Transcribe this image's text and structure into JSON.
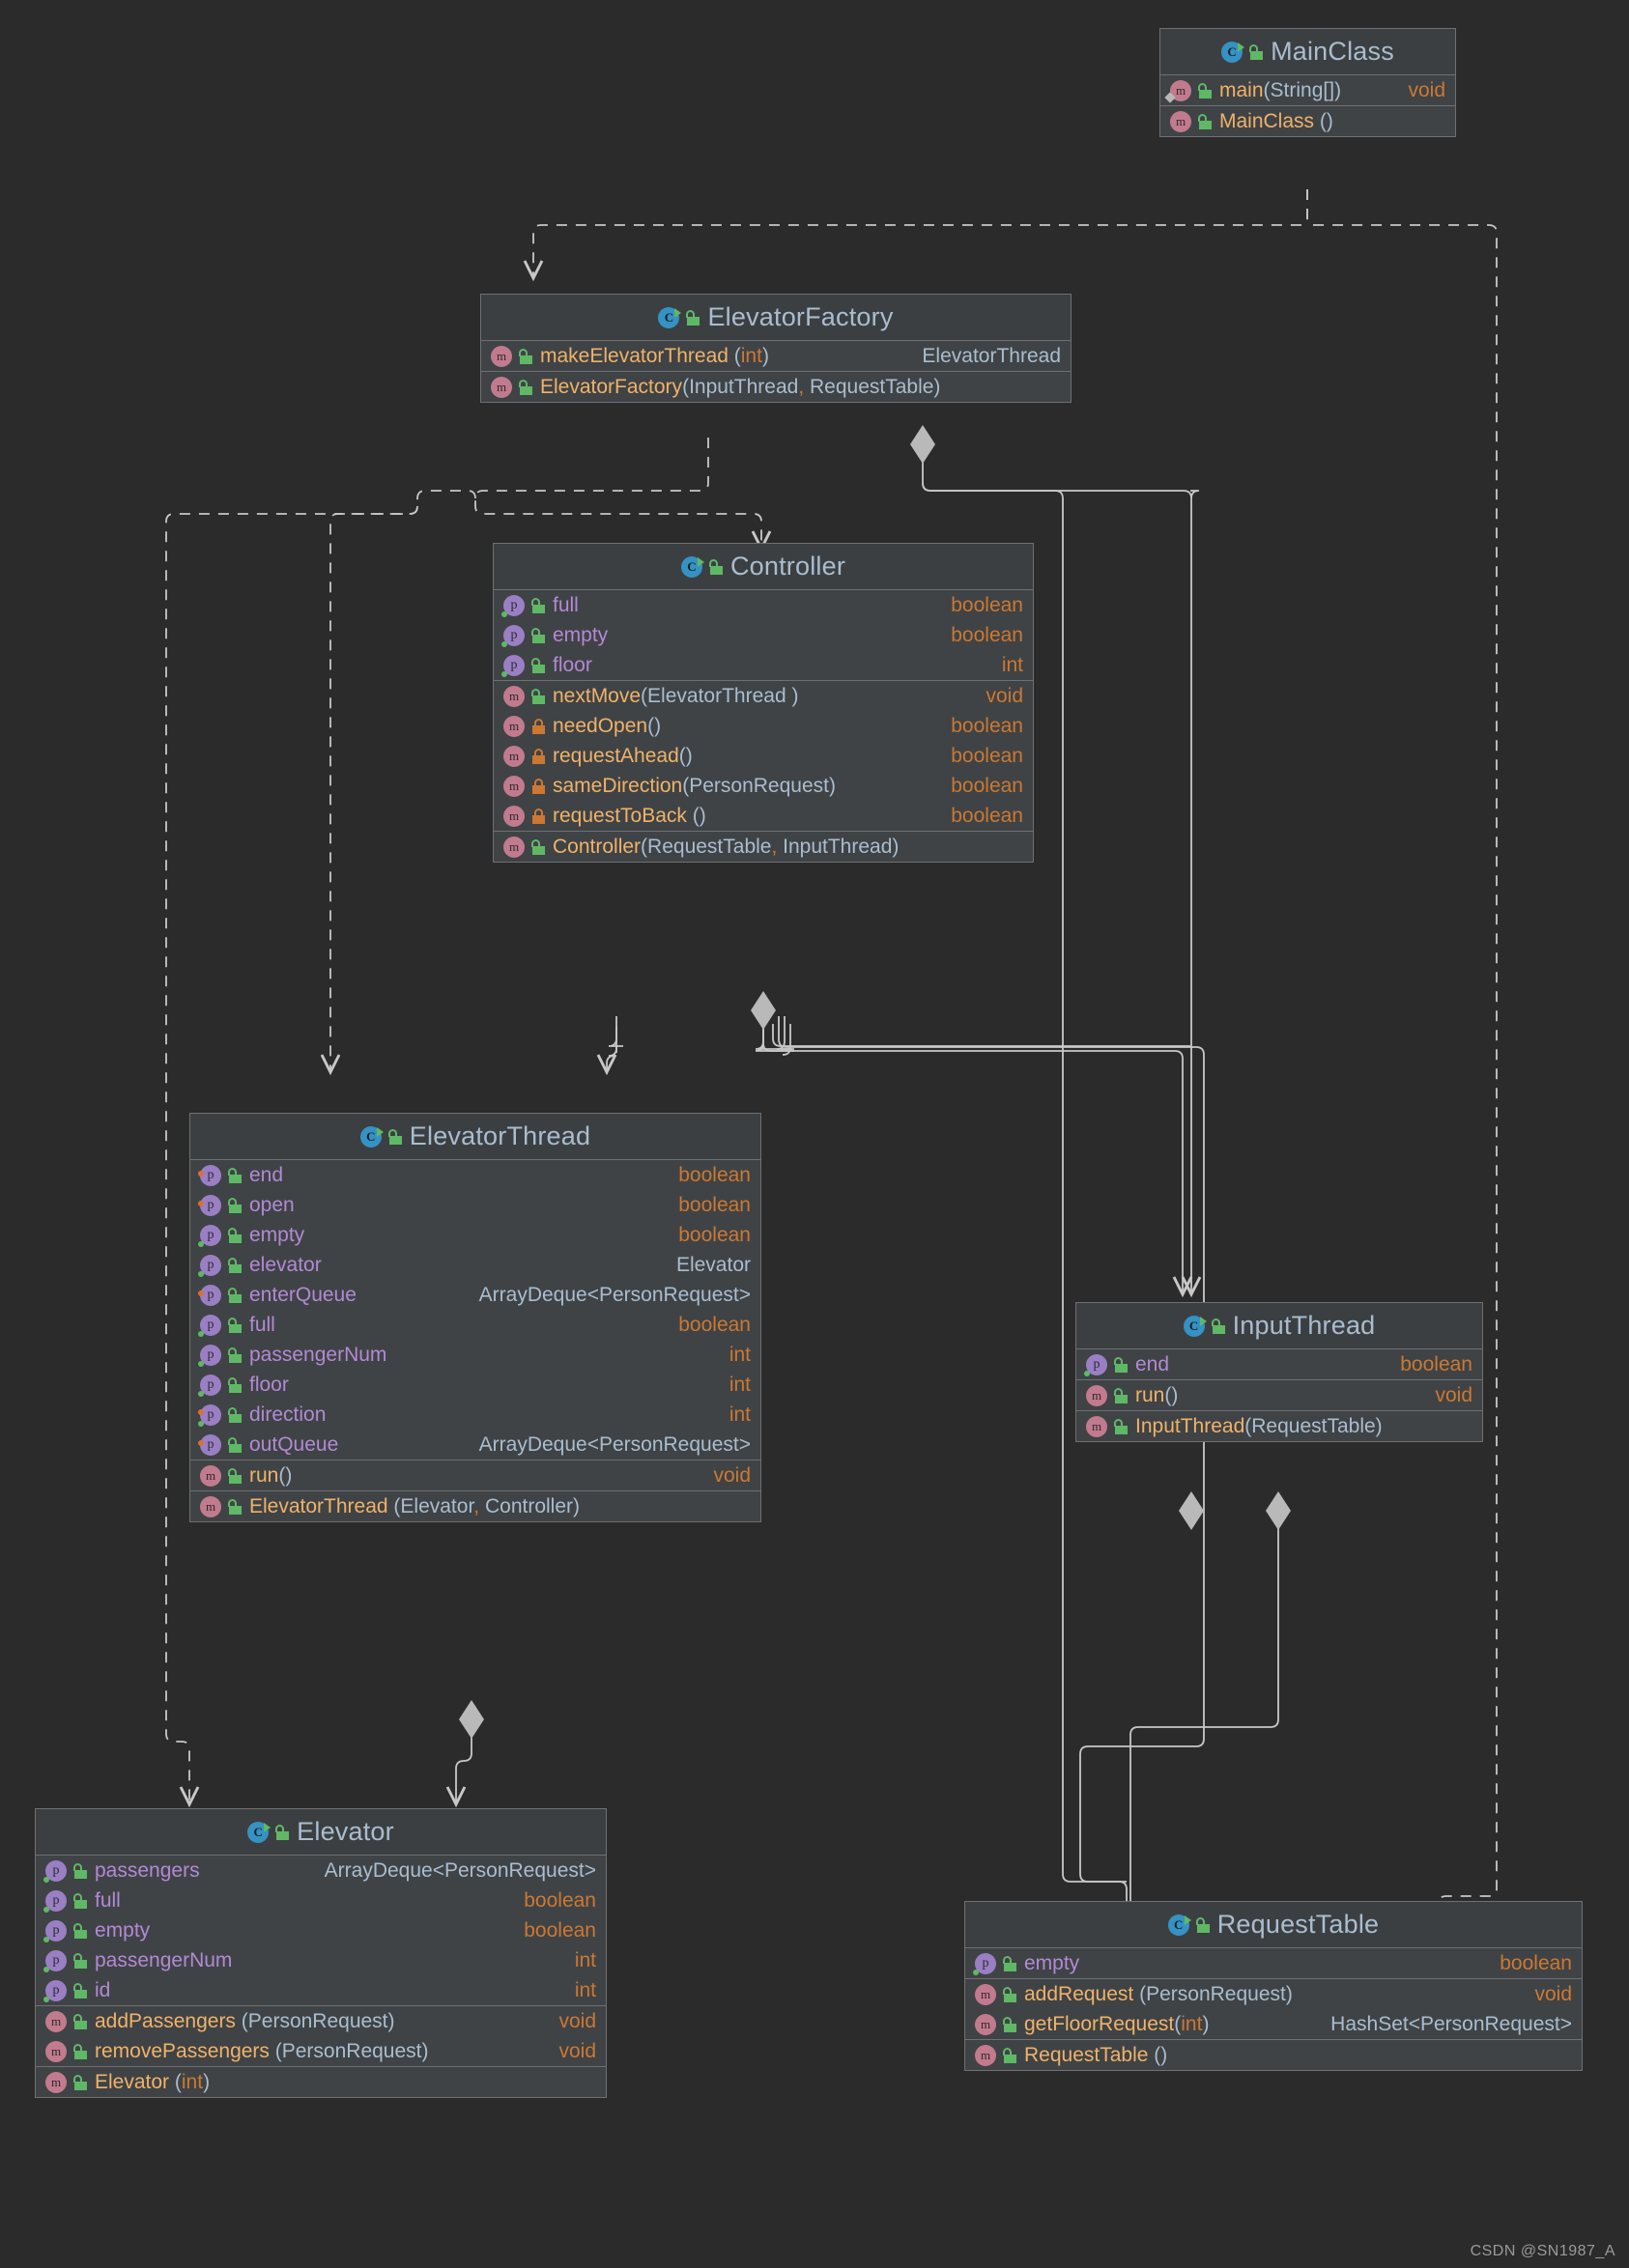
{
  "diagram": {
    "kind": "uml-class-diagram",
    "background_color": "#2b2b2b",
    "box_header_color": "#3c3f41",
    "box_body_color": "#3f4345",
    "border_color": "#6e7072",
    "edge_color": "#c8c8c8",
    "watermark": "CSDN @SN1987_A"
  },
  "icon_legend": {
    "class": "class-icon",
    "property": "property-icon",
    "method": "method-icon",
    "public": "open-padlock-icon",
    "private": "closed-padlock-icon"
  },
  "classes": [
    {
      "id": "MainClass",
      "name": "MainClass",
      "visibility": "public",
      "sections": [
        {
          "members": [
            {
              "kind": "method",
              "visibility": "public",
              "name": "main",
              "params": "String[]",
              "return": "void",
              "marker": "diamond"
            }
          ]
        },
        {
          "members": [
            {
              "kind": "method",
              "visibility": "public",
              "name": "MainClass",
              "params": "",
              "return": ""
            }
          ]
        }
      ]
    },
    {
      "id": "ElevatorFactory",
      "name": "ElevatorFactory",
      "visibility": "public",
      "sections": [
        {
          "members": [
            {
              "kind": "method",
              "visibility": "public",
              "name": "makeElevatorThread",
              "params": "int",
              "param_prim": true,
              "return": "ElevatorThread"
            }
          ]
        },
        {
          "members": [
            {
              "kind": "method",
              "visibility": "public",
              "name": "ElevatorFactory",
              "params": "InputThread, RequestTable",
              "return": ""
            }
          ]
        }
      ]
    },
    {
      "id": "Controller",
      "name": "Controller",
      "visibility": "public",
      "sections": [
        {
          "members": [
            {
              "kind": "property",
              "visibility": "public",
              "name": "full",
              "return": "boolean",
              "marker": "green"
            },
            {
              "kind": "property",
              "visibility": "public",
              "name": "empty",
              "return": "boolean",
              "marker": "green"
            },
            {
              "kind": "property",
              "visibility": "public",
              "name": "floor",
              "return": "int",
              "marker": "green"
            }
          ]
        },
        {
          "members": [
            {
              "kind": "method",
              "visibility": "public",
              "name": "nextMove",
              "params": "ElevatorThread",
              "return": "void"
            },
            {
              "kind": "method",
              "visibility": "private",
              "name": "needOpen",
              "params": "",
              "return": "boolean"
            },
            {
              "kind": "method",
              "visibility": "private",
              "name": "requestAhead",
              "params": "",
              "return": "boolean"
            },
            {
              "kind": "method",
              "visibility": "private",
              "name": "sameDirection",
              "params": "PersonRequest",
              "return": "boolean"
            },
            {
              "kind": "method",
              "visibility": "private",
              "name": "requestToBack",
              "params": "",
              "return": "boolean"
            }
          ]
        },
        {
          "members": [
            {
              "kind": "method",
              "visibility": "public",
              "name": "Controller",
              "params": "RequestTable, InputThread",
              "return": ""
            }
          ]
        }
      ]
    },
    {
      "id": "ElevatorThread",
      "name": "ElevatorThread",
      "visibility": "public",
      "sections": [
        {
          "members": [
            {
              "kind": "property",
              "visibility": "public",
              "name": "end",
              "return": "boolean",
              "marker": "orange"
            },
            {
              "kind": "property",
              "visibility": "public",
              "name": "open",
              "return": "boolean",
              "marker": "orange"
            },
            {
              "kind": "property",
              "visibility": "public",
              "name": "empty",
              "return": "boolean",
              "marker": "green"
            },
            {
              "kind": "property",
              "visibility": "public",
              "name": "elevator",
              "return": "Elevator",
              "marker": "green"
            },
            {
              "kind": "property",
              "visibility": "public",
              "name": "enterQueue",
              "return": "ArrayDeque<PersonRequest>",
              "marker": "orange"
            },
            {
              "kind": "property",
              "visibility": "public",
              "name": "full",
              "return": "boolean",
              "marker": "green"
            },
            {
              "kind": "property",
              "visibility": "public",
              "name": "passengerNum",
              "return": "int",
              "marker": "green"
            },
            {
              "kind": "property",
              "visibility": "public",
              "name": "floor",
              "return": "int",
              "marker": "green"
            },
            {
              "kind": "property",
              "visibility": "public",
              "name": "direction",
              "return": "int",
              "marker": "both"
            },
            {
              "kind": "property",
              "visibility": "public",
              "name": "outQueue",
              "return": "ArrayDeque<PersonRequest>",
              "marker": "orange"
            }
          ]
        },
        {
          "members": [
            {
              "kind": "method",
              "visibility": "public",
              "name": "run",
              "params": "",
              "return": "void"
            }
          ]
        },
        {
          "members": [
            {
              "kind": "method",
              "visibility": "public",
              "name": "ElevatorThread",
              "params": "Elevator, Controller",
              "return": ""
            }
          ]
        }
      ]
    },
    {
      "id": "InputThread",
      "name": "InputThread",
      "visibility": "public",
      "sections": [
        {
          "members": [
            {
              "kind": "property",
              "visibility": "public",
              "name": "end",
              "return": "boolean",
              "marker": "green"
            }
          ]
        },
        {
          "members": [
            {
              "kind": "method",
              "visibility": "public",
              "name": "run",
              "params": "",
              "return": "void"
            }
          ]
        },
        {
          "members": [
            {
              "kind": "method",
              "visibility": "public",
              "name": "InputThread",
              "params": "RequestTable",
              "return": ""
            }
          ]
        }
      ]
    },
    {
      "id": "Elevator",
      "name": "Elevator",
      "visibility": "public",
      "sections": [
        {
          "members": [
            {
              "kind": "property",
              "visibility": "public",
              "name": "passengers",
              "return": "ArrayDeque<PersonRequest>",
              "marker": "green"
            },
            {
              "kind": "property",
              "visibility": "public",
              "name": "full",
              "return": "boolean",
              "marker": "green"
            },
            {
              "kind": "property",
              "visibility": "public",
              "name": "empty",
              "return": "boolean",
              "marker": "green"
            },
            {
              "kind": "property",
              "visibility": "public",
              "name": "passengerNum",
              "return": "int",
              "marker": "green"
            },
            {
              "kind": "property",
              "visibility": "public",
              "name": "id",
              "return": "int",
              "marker": "green"
            }
          ]
        },
        {
          "members": [
            {
              "kind": "method",
              "visibility": "public",
              "name": "addPassengers",
              "params": "PersonRequest",
              "return": "void"
            },
            {
              "kind": "method",
              "visibility": "public",
              "name": "removePassengers",
              "params": "PersonRequest",
              "return": "void"
            }
          ]
        },
        {
          "members": [
            {
              "kind": "method",
              "visibility": "public",
              "name": "Elevator",
              "params": "int",
              "param_prim": true,
              "return": ""
            }
          ]
        }
      ]
    },
    {
      "id": "RequestTable",
      "name": "RequestTable",
      "visibility": "public",
      "sections": [
        {
          "members": [
            {
              "kind": "property",
              "visibility": "public",
              "name": "empty",
              "return": "boolean",
              "marker": "green"
            }
          ]
        },
        {
          "members": [
            {
              "kind": "method",
              "visibility": "public",
              "name": "addRequest",
              "params": "PersonRequest",
              "return": "void"
            },
            {
              "kind": "method",
              "visibility": "public",
              "name": "getFloorRequest",
              "params": "int",
              "param_prim": true,
              "return": "HashSet<PersonRequest>"
            }
          ]
        },
        {
          "members": [
            {
              "kind": "method",
              "visibility": "public",
              "name": "RequestTable",
              "params": "",
              "return": ""
            }
          ]
        }
      ]
    }
  ],
  "relations": [
    {
      "from": "MainClass",
      "to": "ElevatorFactory",
      "type": "dependency"
    },
    {
      "from": "MainClass",
      "to": "RequestTable",
      "type": "dependency"
    },
    {
      "from": "ElevatorFactory",
      "to": "Controller",
      "type": "dependency"
    },
    {
      "from": "ElevatorFactory",
      "to": "ElevatorThread",
      "type": "dependency"
    },
    {
      "from": "ElevatorFactory",
      "to": "Elevator",
      "type": "dependency"
    },
    {
      "from": "ElevatorFactory",
      "to": "InputThread",
      "type": "aggregation"
    },
    {
      "from": "ElevatorFactory",
      "to": "RequestTable",
      "type": "aggregation"
    },
    {
      "from": "Controller",
      "to": "ElevatorThread",
      "type": "aggregation"
    },
    {
      "from": "Controller",
      "to": "InputThread",
      "type": "aggregation"
    },
    {
      "from": "Controller",
      "to": "RequestTable",
      "type": "aggregation"
    },
    {
      "from": "ElevatorThread",
      "to": "Elevator",
      "type": "aggregation"
    },
    {
      "from": "InputThread",
      "to": "RequestTable",
      "type": "aggregation"
    }
  ]
}
